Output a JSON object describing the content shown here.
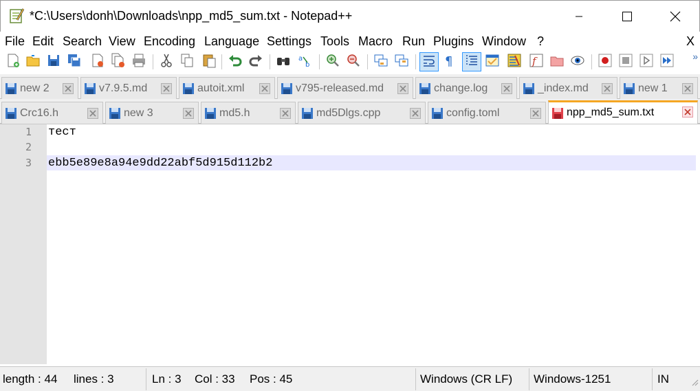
{
  "window": {
    "title": "*C:\\Users\\donh\\Downloads\\npp_md5_sum.txt - Notepad++",
    "minimize_icon": "minimize-icon",
    "maximize_icon": "maximize-icon",
    "close_icon": "close-icon"
  },
  "menu": {
    "items": [
      "File",
      "Edit",
      "Search",
      "View",
      "Encoding",
      "Language",
      "Settings",
      "Tools",
      "Macro",
      "Run",
      "Plugins",
      "Window",
      "?"
    ],
    "close_label": "X"
  },
  "toolbar": {
    "buttons": [
      "new-file-icon",
      "open-file-icon",
      "save-icon",
      "save-all-icon",
      "close-icon",
      "close-all-icon",
      "print-icon",
      "cut-icon",
      "copy-icon",
      "paste-icon",
      "undo-icon",
      "redo-icon",
      "find-icon",
      "replace-icon",
      "zoom-in-icon",
      "zoom-out-icon",
      "sync-vertical-icon",
      "sync-horizontal-icon",
      "word-wrap-icon",
      "show-all-chars-icon",
      "indent-guide-icon",
      "udl-icon",
      "doc-map-icon",
      "function-list-icon",
      "folder-workspace-icon",
      "monitoring-icon",
      "record-macro-icon",
      "stop-macro-icon",
      "play-macro-icon",
      "run-macro-multiple-icon"
    ],
    "more_label": "»"
  },
  "tabs_row1": [
    {
      "label": "new 2"
    },
    {
      "label": "v7.9.5.md"
    },
    {
      "label": "autoit.xml"
    },
    {
      "label": "v795-released.md"
    },
    {
      "label": "change.log"
    },
    {
      "label": "_index.md"
    },
    {
      "label": "new 1"
    }
  ],
  "tabs_row2": [
    {
      "label": "Crc16.h"
    },
    {
      "label": "new 3"
    },
    {
      "label": "md5.h"
    },
    {
      "label": "md5Dlgs.cpp"
    },
    {
      "label": "config.toml"
    },
    {
      "label": "npp_md5_sum.txt"
    }
  ],
  "editor": {
    "lines": [
      {
        "number": "1",
        "text": "тест"
      },
      {
        "number": "2",
        "text": ""
      },
      {
        "number": "3",
        "text": "ebb5e89e8a94e9dd22abf5d915d112b2"
      }
    ],
    "current_line_color": "#e8e8ff"
  },
  "status": {
    "length": "length : 44",
    "lines": "lines : 3",
    "ln": "Ln : 3",
    "col": "Col : 33",
    "pos": "Pos : 45",
    "eol": "Windows (CR LF)",
    "encoding": "Windows-1251",
    "mode": "IN"
  },
  "colors": {
    "active_tab_accent": "#f5a623",
    "save_icon_blue": "#3a78c9",
    "save_icon_red": "#e0404a"
  }
}
